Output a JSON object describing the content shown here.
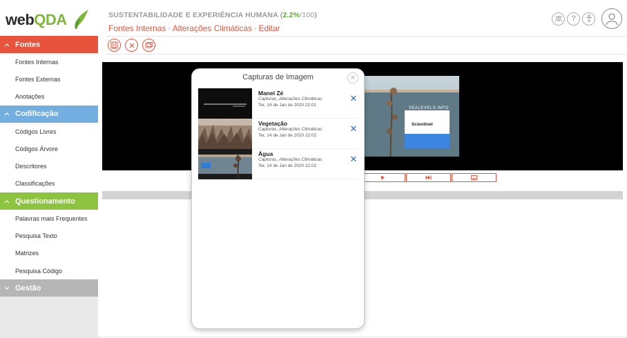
{
  "app": {
    "logo_web": "web",
    "logo_qda": "QDA"
  },
  "sidebar": {
    "sections": [
      {
        "label": "Fontes",
        "items": [
          "Fontes Internas",
          "Fontes Externas",
          "Anotações"
        ]
      },
      {
        "label": "Codificação",
        "items": [
          "Códigos Livres",
          "Códigos Árvore",
          "Descritores",
          "Classificações"
        ]
      },
      {
        "label": "Questionamento",
        "items": [
          "Palavras mais Frequentes",
          "Pesquisa Texto",
          "Matrizes",
          "Pesquisa Código"
        ]
      },
      {
        "label": "Gestão",
        "items": []
      }
    ]
  },
  "header": {
    "project_name": "SUSTENTABILIDADE E EXPERIÊNCIA HUMANA",
    "project_pct": "2.2%",
    "project_total": "/100",
    "breadcrumb": [
      "Fontes Internas",
      "Alterações Climáticas",
      "Editar"
    ]
  },
  "modal": {
    "title": "Capturas de Imagem",
    "captures": [
      {
        "name": "Manel Zé",
        "source": "Capturas_Alterações Climáticas",
        "date": "Ter, 14 de Jan de 2020 22:01"
      },
      {
        "name": "Vegetação",
        "source": "Capturas_Alterações Climáticas",
        "date": "Ter, 14 de Jan de 2020 22:02"
      },
      {
        "name": "Água",
        "source": "Capturas_Alterações Climáticas",
        "date": "Ter, 14 de Jan de 2020 22:02"
      }
    ]
  },
  "video": {
    "overlay_site": "SEALEVELS.INFO",
    "overlay_brand": "Scientinel"
  },
  "colors": {
    "accent": "#e8533b",
    "fontes": "#e8533b",
    "codificacao": "#72aee0",
    "questionamento": "#8cc33f",
    "gestao": "#b6b6b6",
    "pct": "#5aaa32",
    "delete": "#2a6cc1"
  }
}
